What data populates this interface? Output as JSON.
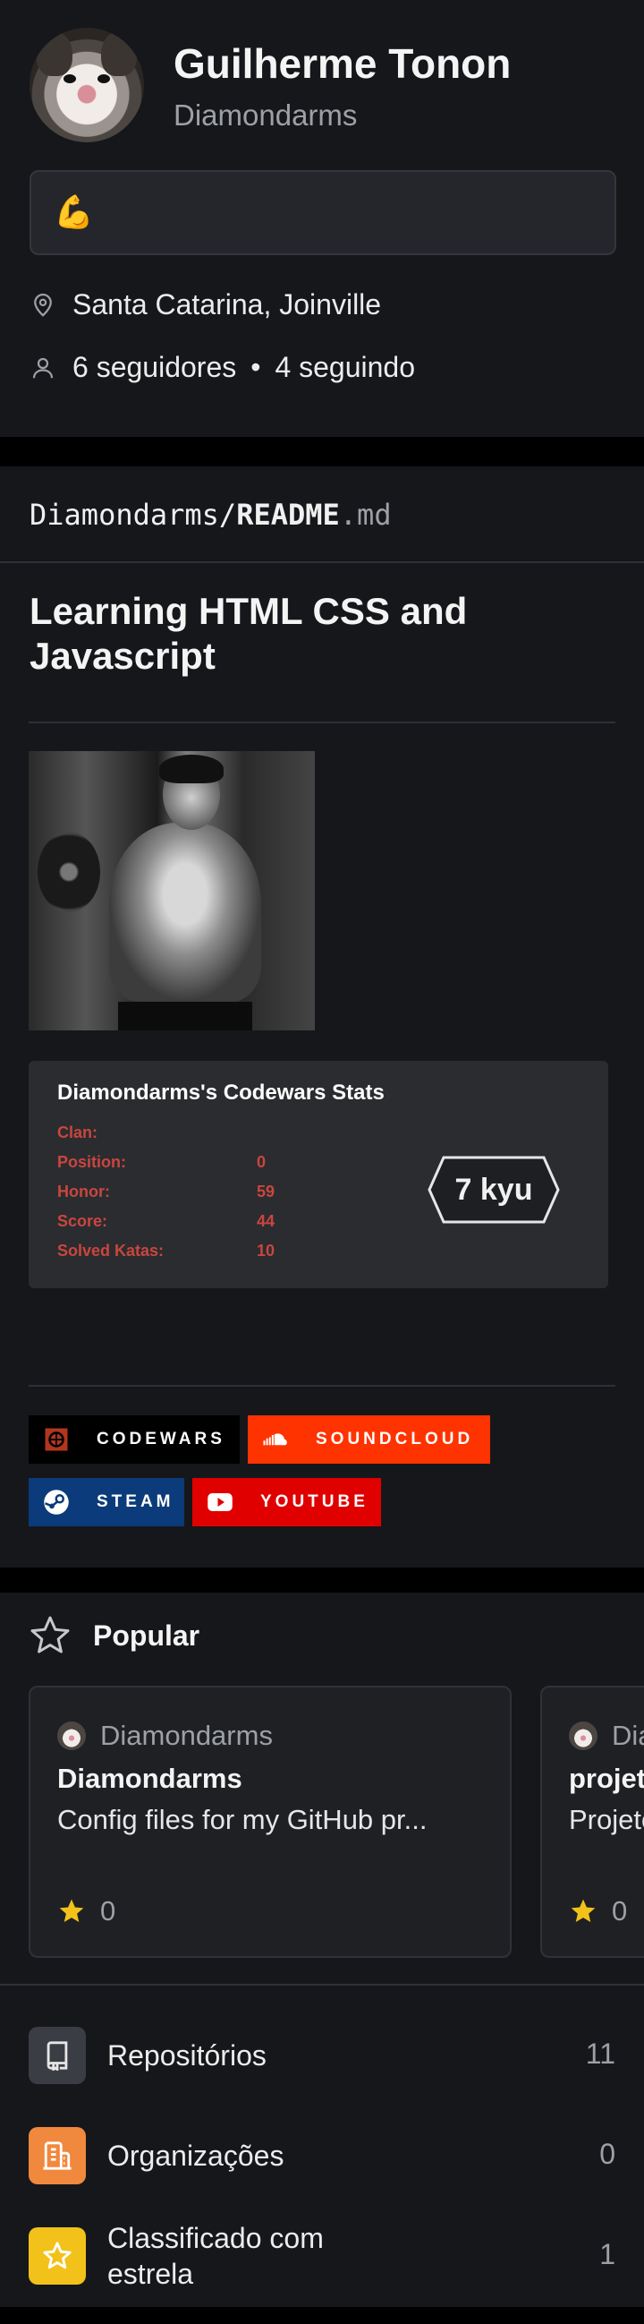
{
  "profile": {
    "name": "Guilherme Tonon",
    "login": "Diamondarms",
    "status_emoji": "💪",
    "location": "Santa Catarina, Joinville",
    "followers": "6 seguidores",
    "separator": "•",
    "following": "4 seguindo"
  },
  "readme": {
    "owner": "Diamondarms/",
    "file": "README",
    "ext": ".md",
    "title": "Learning HTML CSS and Javascript",
    "codewars": {
      "title": "Diamondarms's Codewars Stats",
      "rows": [
        {
          "label": "Clan:",
          "value": ""
        },
        {
          "label": "Position:",
          "value": "0"
        },
        {
          "label": "Honor:",
          "value": "59"
        },
        {
          "label": "Score:",
          "value": "44"
        },
        {
          "label": "Solved Katas:",
          "value": "10"
        }
      ],
      "rank": "7 kyu"
    },
    "badges": [
      "CODEWARS",
      "SOUNDCLOUD",
      "STEAM",
      "YOUTUBE"
    ]
  },
  "popular": {
    "title": "Popular",
    "repos": [
      {
        "owner": "Diamondarms",
        "name": "Diamondarms",
        "description": "Config files for my GitHub pr...",
        "stars": "0"
      },
      {
        "owner": "Diamondarms",
        "name": "projeto",
        "description": "Projeto",
        "stars": "0"
      }
    ]
  },
  "links": [
    {
      "label": "Repositórios",
      "count": "11",
      "color": "#3b3d44",
      "icon": "repo-icon"
    },
    {
      "label": "Organizações",
      "count": "0",
      "color": "#f0883e",
      "icon": "organization-icon"
    },
    {
      "label": "Classificado com estrela",
      "count": "1",
      "color": "#f2c21b",
      "icon": "star-icon"
    }
  ],
  "colors": {
    "background": "#16171b",
    "codewars_red": "#c9463f",
    "soundcloud": "#ff3300",
    "steam": "#0b3b7a",
    "youtube": "#e00000"
  }
}
